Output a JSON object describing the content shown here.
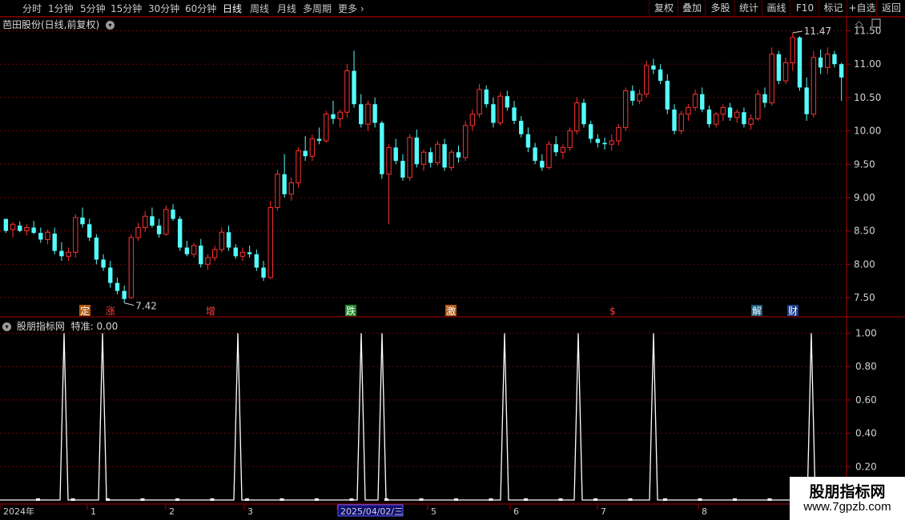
{
  "toolbar": {
    "periods": [
      {
        "label": "分时",
        "active": false
      },
      {
        "label": "1分钟",
        "active": false
      },
      {
        "label": "5分钟",
        "active": false
      },
      {
        "label": "15分钟",
        "active": false
      },
      {
        "label": "30分钟",
        "active": false
      },
      {
        "label": "60分钟",
        "active": false
      },
      {
        "label": "日线",
        "active": true
      },
      {
        "label": "周线",
        "active": false
      },
      {
        "label": "月线",
        "active": false
      },
      {
        "label": "多周期",
        "active": false
      }
    ],
    "more_label": "更多",
    "more_icon": "chevron-right-icon",
    "right_buttons": [
      "复权",
      "叠加",
      "多股",
      "统计",
      "画线",
      "F10",
      "标记",
      "+自选",
      "返回"
    ]
  },
  "main_chart": {
    "title": "芭田股份(日线,前复权)",
    "title_icon": "chevron-down-icon",
    "corner_icons": [
      "diamond-icon",
      "window-icon"
    ],
    "price_axis": [
      "11.50",
      "11.00",
      "10.50",
      "10.00",
      "9.50",
      "9.00",
      "8.50",
      "8.00",
      "7.50"
    ],
    "high_label": "11.47",
    "low_label": "7.42",
    "up_color": "#ff3030",
    "down_color": "#54fcfc",
    "event_markers": [
      {
        "text": "定",
        "bg": "#b05a10",
        "fg": "#ffffff"
      },
      {
        "text": "涨",
        "bg": "#000000",
        "fg": "#ff4040"
      },
      {
        "text": "增",
        "bg": "#000000",
        "fg": "#ff4040"
      },
      {
        "text": "跌",
        "bg": "#1f8a2a",
        "fg": "#ffffff"
      },
      {
        "text": "激",
        "bg": "#b05a10",
        "fg": "#ffffff"
      },
      {
        "text": "$",
        "bg": "#000000",
        "fg": "#ff4040"
      },
      {
        "text": "解",
        "bg": "#1a5a7a",
        "fg": "#ffffff"
      },
      {
        "text": "财",
        "bg": "#1a3a8a",
        "fg": "#ffffff"
      }
    ]
  },
  "indicator": {
    "title": "股朋指标网",
    "value_label": "特准: 0.00",
    "title_icon": "chevron-down-icon",
    "axis": [
      "1.00",
      "0.80",
      "0.60",
      "0.40",
      "0.20"
    ],
    "signal_count": 10
  },
  "date_axis": {
    "labels": [
      "2024年",
      "1",
      "2",
      "3",
      "2025/04/02/三",
      "5",
      "6",
      "7",
      "8"
    ],
    "highlight": "2025/04/02/三"
  },
  "watermark": {
    "line1": "股朋指标网",
    "line2": "www.7gpzb.com"
  },
  "chart_data": {
    "type": "candlestick",
    "title": "芭田股份(日线,前复权)",
    "ylim": [
      7.25,
      11.75
    ],
    "y_ticks": [
      7.5,
      8.0,
      8.5,
      9.0,
      9.5,
      10.0,
      10.5,
      11.0,
      11.5
    ],
    "high": 11.47,
    "low": 7.42,
    "candles": [
      [
        8.68,
        8.68,
        8.47,
        8.5
      ],
      [
        8.52,
        8.63,
        8.4,
        8.6
      ],
      [
        8.58,
        8.64,
        8.48,
        8.5
      ],
      [
        8.5,
        8.6,
        8.43,
        8.55
      ],
      [
        8.55,
        8.65,
        8.45,
        8.47
      ],
      [
        8.47,
        8.55,
        8.32,
        8.37
      ],
      [
        8.37,
        8.52,
        8.3,
        8.48
      ],
      [
        8.46,
        8.55,
        8.15,
        8.2
      ],
      [
        8.2,
        8.33,
        8.05,
        8.12
      ],
      [
        8.12,
        8.25,
        8.05,
        8.18
      ],
      [
        8.18,
        8.75,
        8.1,
        8.7
      ],
      [
        8.7,
        8.85,
        8.55,
        8.6
      ],
      [
        8.6,
        8.68,
        8.35,
        8.4
      ],
      [
        8.4,
        8.45,
        8.0,
        8.07
      ],
      [
        8.07,
        8.15,
        7.9,
        7.95
      ],
      [
        7.95,
        8.05,
        7.65,
        7.72
      ],
      [
        7.72,
        7.8,
        7.55,
        7.6
      ],
      [
        7.6,
        7.68,
        7.42,
        7.48
      ],
      [
        7.5,
        8.45,
        7.48,
        8.4
      ],
      [
        8.4,
        8.62,
        8.35,
        8.55
      ],
      [
        8.55,
        8.8,
        8.48,
        8.72
      ],
      [
        8.72,
        8.85,
        8.55,
        8.58
      ],
      [
        8.58,
        8.68,
        8.4,
        8.45
      ],
      [
        8.45,
        8.88,
        8.43,
        8.82
      ],
      [
        8.82,
        8.9,
        8.65,
        8.68
      ],
      [
        8.68,
        8.72,
        8.2,
        8.25
      ],
      [
        8.25,
        8.35,
        8.12,
        8.15
      ],
      [
        8.15,
        8.32,
        8.1,
        8.28
      ],
      [
        8.28,
        8.38,
        7.95,
        8.0
      ],
      [
        8.0,
        8.15,
        7.92,
        8.1
      ],
      [
        8.1,
        8.28,
        8.05,
        8.22
      ],
      [
        8.22,
        8.55,
        8.18,
        8.48
      ],
      [
        8.48,
        8.58,
        8.2,
        8.25
      ],
      [
        8.25,
        8.3,
        8.08,
        8.12
      ],
      [
        8.12,
        8.25,
        8.05,
        8.18
      ],
      [
        8.18,
        8.28,
        8.1,
        8.15
      ],
      [
        8.15,
        8.22,
        7.9,
        7.95
      ],
      [
        7.95,
        8.05,
        7.75,
        7.8
      ],
      [
        7.8,
        8.95,
        7.78,
        8.85
      ],
      [
        8.85,
        9.42,
        8.8,
        9.35
      ],
      [
        9.35,
        9.65,
        9.0,
        9.05
      ],
      [
        9.05,
        9.3,
        8.95,
        9.22
      ],
      [
        9.22,
        9.75,
        9.15,
        9.7
      ],
      [
        9.7,
        9.92,
        9.55,
        9.62
      ],
      [
        9.62,
        9.95,
        9.55,
        9.88
      ],
      [
        9.88,
        10.05,
        9.8,
        9.85
      ],
      [
        9.85,
        10.3,
        9.82,
        10.25
      ],
      [
        10.25,
        10.45,
        10.1,
        10.18
      ],
      [
        10.18,
        10.32,
        10.05,
        10.28
      ],
      [
        10.28,
        11.0,
        10.2,
        10.9
      ],
      [
        10.9,
        11.2,
        10.35,
        10.4
      ],
      [
        10.4,
        10.55,
        10.05,
        10.1
      ],
      [
        10.1,
        10.45,
        10.0,
        10.4
      ],
      [
        10.4,
        10.5,
        10.05,
        10.12
      ],
      [
        10.12,
        10.15,
        9.28,
        9.35
      ],
      [
        9.35,
        9.8,
        8.6,
        9.75
      ],
      [
        9.75,
        9.88,
        9.5,
        9.55
      ],
      [
        9.55,
        9.65,
        9.25,
        9.3
      ],
      [
        9.3,
        9.95,
        9.25,
        9.9
      ],
      [
        9.9,
        10.02,
        9.45,
        9.5
      ],
      [
        9.5,
        9.72,
        9.4,
        9.68
      ],
      [
        9.68,
        9.75,
        9.45,
        9.52
      ],
      [
        9.52,
        9.85,
        9.48,
        9.8
      ],
      [
        9.8,
        9.88,
        9.4,
        9.45
      ],
      [
        9.45,
        9.72,
        9.4,
        9.68
      ],
      [
        9.68,
        9.78,
        9.52,
        9.6
      ],
      [
        9.6,
        10.15,
        9.55,
        10.08
      ],
      [
        10.08,
        10.32,
        10.0,
        10.25
      ],
      [
        10.25,
        10.7,
        10.2,
        10.62
      ],
      [
        10.62,
        10.68,
        10.35,
        10.4
      ],
      [
        10.4,
        10.5,
        10.05,
        10.12
      ],
      [
        10.12,
        10.58,
        10.08,
        10.52
      ],
      [
        10.52,
        10.6,
        10.3,
        10.35
      ],
      [
        10.35,
        10.45,
        10.1,
        10.15
      ],
      [
        10.15,
        10.22,
        9.9,
        9.95
      ],
      [
        9.95,
        10.05,
        9.68,
        9.75
      ],
      [
        9.75,
        9.82,
        9.5,
        9.55
      ],
      [
        9.55,
        9.65,
        9.4,
        9.45
      ],
      [
        9.45,
        9.85,
        9.42,
        9.8
      ],
      [
        9.8,
        9.92,
        9.62,
        9.68
      ],
      [
        9.68,
        9.8,
        9.58,
        9.75
      ],
      [
        9.75,
        10.05,
        9.7,
        10.0
      ],
      [
        10.0,
        10.5,
        9.95,
        10.42
      ],
      [
        10.42,
        10.48,
        10.05,
        10.1
      ],
      [
        10.1,
        10.15,
        9.82,
        9.88
      ],
      [
        9.88,
        9.95,
        9.75,
        9.82
      ],
      [
        9.82,
        9.9,
        9.72,
        9.8
      ],
      [
        9.8,
        9.95,
        9.7,
        9.85
      ],
      [
        9.85,
        10.1,
        9.78,
        10.05
      ],
      [
        10.05,
        10.65,
        10.0,
        10.6
      ],
      [
        10.6,
        10.68,
        10.38,
        10.45
      ],
      [
        10.45,
        10.62,
        10.4,
        10.55
      ],
      [
        10.55,
        11.05,
        10.5,
        10.98
      ],
      [
        10.98,
        11.08,
        10.85,
        10.92
      ],
      [
        10.92,
        11.0,
        10.7,
        10.75
      ],
      [
        10.75,
        10.85,
        10.25,
        10.32
      ],
      [
        10.32,
        10.4,
        9.95,
        10.0
      ],
      [
        10.0,
        10.3,
        9.95,
        10.25
      ],
      [
        10.25,
        10.4,
        10.15,
        10.35
      ],
      [
        10.35,
        10.62,
        10.3,
        10.55
      ],
      [
        10.55,
        10.65,
        10.28,
        10.32
      ],
      [
        10.32,
        10.38,
        10.05,
        10.1
      ],
      [
        10.1,
        10.28,
        10.05,
        10.25
      ],
      [
        10.25,
        10.4,
        10.15,
        10.35
      ],
      [
        10.35,
        10.42,
        10.15,
        10.2
      ],
      [
        10.2,
        10.32,
        10.12,
        10.28
      ],
      [
        10.28,
        10.35,
        10.05,
        10.1
      ],
      [
        10.1,
        10.25,
        10.02,
        10.18
      ],
      [
        10.18,
        10.62,
        10.15,
        10.55
      ],
      [
        10.55,
        10.65,
        10.35,
        10.42
      ],
      [
        10.42,
        11.25,
        10.38,
        11.15
      ],
      [
        11.15,
        11.2,
        10.7,
        10.75
      ],
      [
        10.75,
        11.1,
        10.7,
        11.02
      ],
      [
        11.02,
        11.47,
        10.9,
        11.4
      ],
      [
        11.4,
        11.42,
        10.6,
        10.65
      ],
      [
        10.65,
        10.8,
        10.15,
        10.25
      ],
      [
        10.25,
        11.2,
        10.2,
        11.1
      ],
      [
        11.1,
        11.22,
        10.85,
        10.95
      ],
      [
        10.95,
        11.25,
        10.85,
        11.15
      ],
      [
        11.15,
        11.2,
        10.95,
        11.0
      ],
      [
        11.0,
        11.02,
        10.45,
        10.8
      ]
    ],
    "indicator_series": {
      "name": "特准",
      "total_bars": 131,
      "signal_bars": [
        16,
        25,
        60,
        90,
        95,
        126,
        145,
        163,
        201
      ],
      "values_signal": 1.0,
      "values_baseline": 0.0,
      "ylim": [
        0,
        1.1
      ]
    }
  }
}
